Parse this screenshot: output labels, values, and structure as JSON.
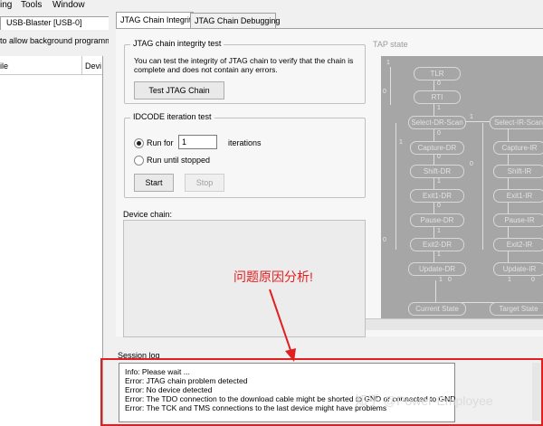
{
  "menubar": {
    "items": [
      "ing",
      "Tools",
      "Window"
    ]
  },
  "left": {
    "tab_label": "USB-Blaster [USB-0]",
    "info_text": "to allow background programmi",
    "columns": [
      "ile",
      "Devi"
    ]
  },
  "tabs": [
    {
      "label": "JTAG Chain Integrity"
    },
    {
      "label": "JTAG Chain Debugging"
    }
  ],
  "integrity": {
    "legend": "JTAG chain integrity test",
    "description_line1": "You can test the integrity of JTAG chain to verify that the chain is",
    "description_line2": "complete and does not contain any errors.",
    "test_button": "Test JTAG Chain"
  },
  "idcode": {
    "legend": "IDCODE iteration test",
    "run_for_label": "Run for",
    "iterations_value": "1",
    "iterations_label": "iterations",
    "run_until_label": "Run until stopped",
    "start_button": "Start",
    "stop_button": "Stop"
  },
  "device_chain": {
    "label": "Device chain:"
  },
  "tap": {
    "label": "TAP state",
    "nodes": {
      "tlr": "TLR",
      "rti": "RTI",
      "sel_dr": "Select-DR-Scan",
      "sel_ir": "Select-IR-Scan",
      "cap_dr": "Capture-DR",
      "cap_ir": "Capture-IR",
      "shift_dr": "Shift-DR",
      "shift_ir": "Shift-IR",
      "exit1_dr": "Exit1-DR",
      "exit1_ir": "Exit1-IR",
      "pause_dr": "Pause-DR",
      "pause_ir": "Pause-IR",
      "exit2_dr": "Exit2-DR",
      "exit2_ir": "Exit2-IR",
      "update_dr": "Update-DR",
      "update_ir": "Update-IR",
      "current": "Current State",
      "target": "Target State"
    },
    "trans": {
      "one": "1",
      "zero": "0"
    }
  },
  "session": {
    "label": "Session log",
    "lines": [
      "Info: Please wait ...",
      "Error: JTAG chain problem detected",
      "Error: No device detected",
      "Error: The TDO connection to the download cable might be shorted to GND or connected to GND",
      "Error: The TCK and TMS connections to the last device might have problems"
    ]
  },
  "annotation": {
    "text": "问题原因分析!",
    "color": "#e02020"
  },
  "watermark": {
    "text": "知乎 @Power-Employee"
  }
}
